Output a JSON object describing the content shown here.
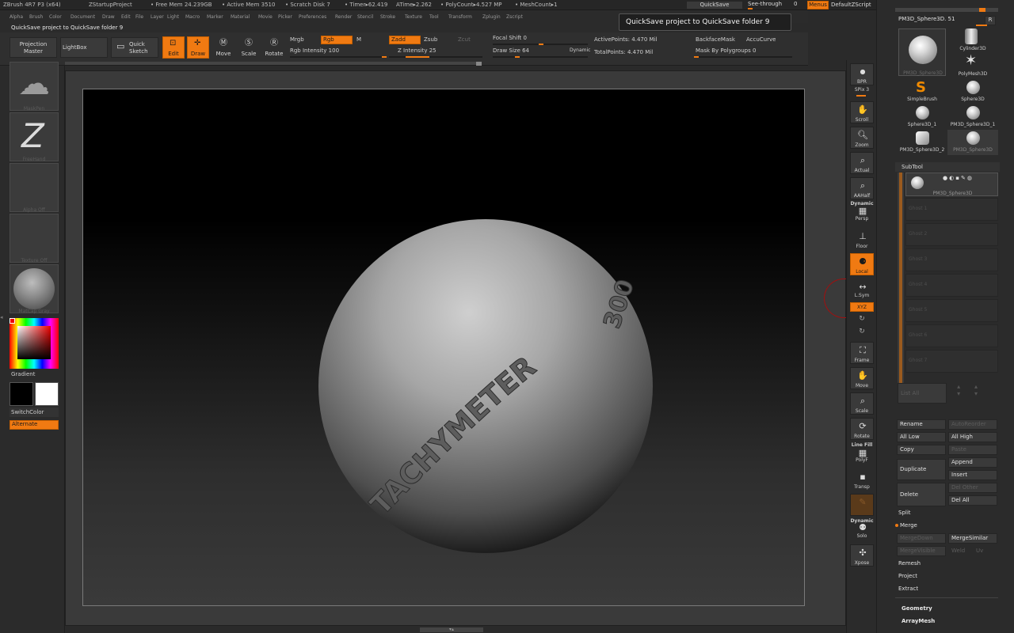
{
  "titlebar": {
    "app": "ZBrush 4R7 P3 (x64)",
    "project": "ZStartupProject",
    "free_mem": "• Free Mem 24.239GB",
    "active_mem": "• Active Mem 3510",
    "scratch": "• Scratch Disk 7",
    "timer": "• Timer▸62.419",
    "atime": "ATime▸2.262",
    "polycount": "• PolyCount▸4.527 MP",
    "meshcount": "• MeshCount▸1",
    "quicksave": "QuickSave",
    "see_through": "See-through",
    "see_through_value": "0",
    "menus": "Menus",
    "default_zscript": "DefaultZScript"
  },
  "menubar": [
    "Alpha",
    "Brush",
    "Color",
    "Document",
    "Draw",
    "Edit",
    "File",
    "Layer",
    "Light",
    "Macro",
    "Marker",
    "Material",
    "Movie",
    "Picker",
    "Preferences",
    "Render",
    "Stencil",
    "Stroke",
    "Texture",
    "Tool",
    "Transform",
    "Zplugin",
    "Zscript"
  ],
  "notice": "QuickSave project to QuickSave folder  9",
  "tooltip": "QuickSave project to QuickSave folder  9",
  "toolbar": {
    "projection_master": "Projection Master",
    "lightbox": "LightBox",
    "quick_sketch": "Quick Sketch",
    "edit": "Edit",
    "draw": "Draw",
    "move": "Move",
    "scale": "Scale",
    "rotate": "Rotate",
    "mrgb": "Mrgb",
    "rgb": "Rgb",
    "m": "M",
    "zadd": "Zadd",
    "zsub": "Zsub",
    "zcut": "Zcut",
    "rgb_intensity": "Rgb Intensity 100",
    "z_intensity": "Z Intensity 25",
    "focal_shift": "Focal Shift 0",
    "draw_size": "Draw Size 64",
    "dynamic": "Dynamic",
    "active_points": "ActivePoints: 4.470  Mil",
    "total_points": "TotalPoints: 4.470  Mil",
    "backface_mask": "BackfaceMask",
    "accucurve": "AccuCurve",
    "mask_by_polygroups": "Mask By Polygroups 0"
  },
  "leftshelf": {
    "brush": "MaskPen",
    "stroke": "FreeHand",
    "alpha": "Alpha  Off",
    "texture": "Texture  Off",
    "material": "MatCap  Gray",
    "gradient": "Gradient",
    "switch_color": "SwitchColor",
    "alternate": "Alternate"
  },
  "canvas": {
    "engraving_main": "TACHYMETER",
    "engraving_number": "300"
  },
  "rightshelf": {
    "bpr": "BPR",
    "spix": "SPix 3",
    "scroll": "Scroll",
    "zoom": "Zoom",
    "actual": "Actual",
    "aahalf": "AAHalf",
    "dynamic": "Dynamic",
    "persp": "Persp",
    "floor": "Floor",
    "local": "Local",
    "lsym": "L.Sym",
    "xyz": "XYZ",
    "frame": "Frame",
    "move": "Move",
    "scale": "Scale",
    "rotate": "Rotate",
    "line_fill": "Line Fill",
    "polyf": "PolyF",
    "transp": "Transp",
    "dynamic2": "Dynamic",
    "solo": "Solo",
    "xpose": "Xpose"
  },
  "toolpanel": {
    "current_tool": "PM3D_Sphere3D. 51",
    "r": "R",
    "tools": [
      "PM3D_Sphere3D",
      "Cylinder3D",
      "PolyMesh3D",
      "SimpleBrush",
      "Sphere3D",
      "Sphere3D_1",
      "PM3D_Sphere3D_1",
      "PM3D_Sphere3D_2",
      "PM3D_Sphere3D"
    ],
    "subtool_title": "SubTool",
    "subtool_active": "PM3D_Sphere3D",
    "slots": [
      "Ghost 1",
      "Ghost 2",
      "Ghost 3",
      "Ghost 4",
      "Ghost 5",
      "Ghost 6",
      "Ghost 7"
    ],
    "list_all": "List  All",
    "rename": "Rename",
    "autoreorder": "AutoReorder",
    "all_low": "All Low",
    "all_high": "All High",
    "copy": "Copy",
    "paste": "Paste",
    "append": "Append",
    "duplicate": "Duplicate",
    "insert": "Insert",
    "delete": "Delete",
    "del_other": "Del Other",
    "del_all": "Del All",
    "split": "Split",
    "merge": "Merge",
    "mergedown": "MergeDown",
    "mergesimilar": "MergeSimilar",
    "mergevisible": "MergeVisible",
    "weld": "Weld",
    "uv": "Uv",
    "remesh": "Remesh",
    "project": "Project",
    "extract": "Extract",
    "geometry": "Geometry",
    "arraymesh": "ArrayMesh"
  },
  "colors": {
    "accent": "#f07a12",
    "panel": "#2b2b2b",
    "button": "#3a3a3a"
  }
}
